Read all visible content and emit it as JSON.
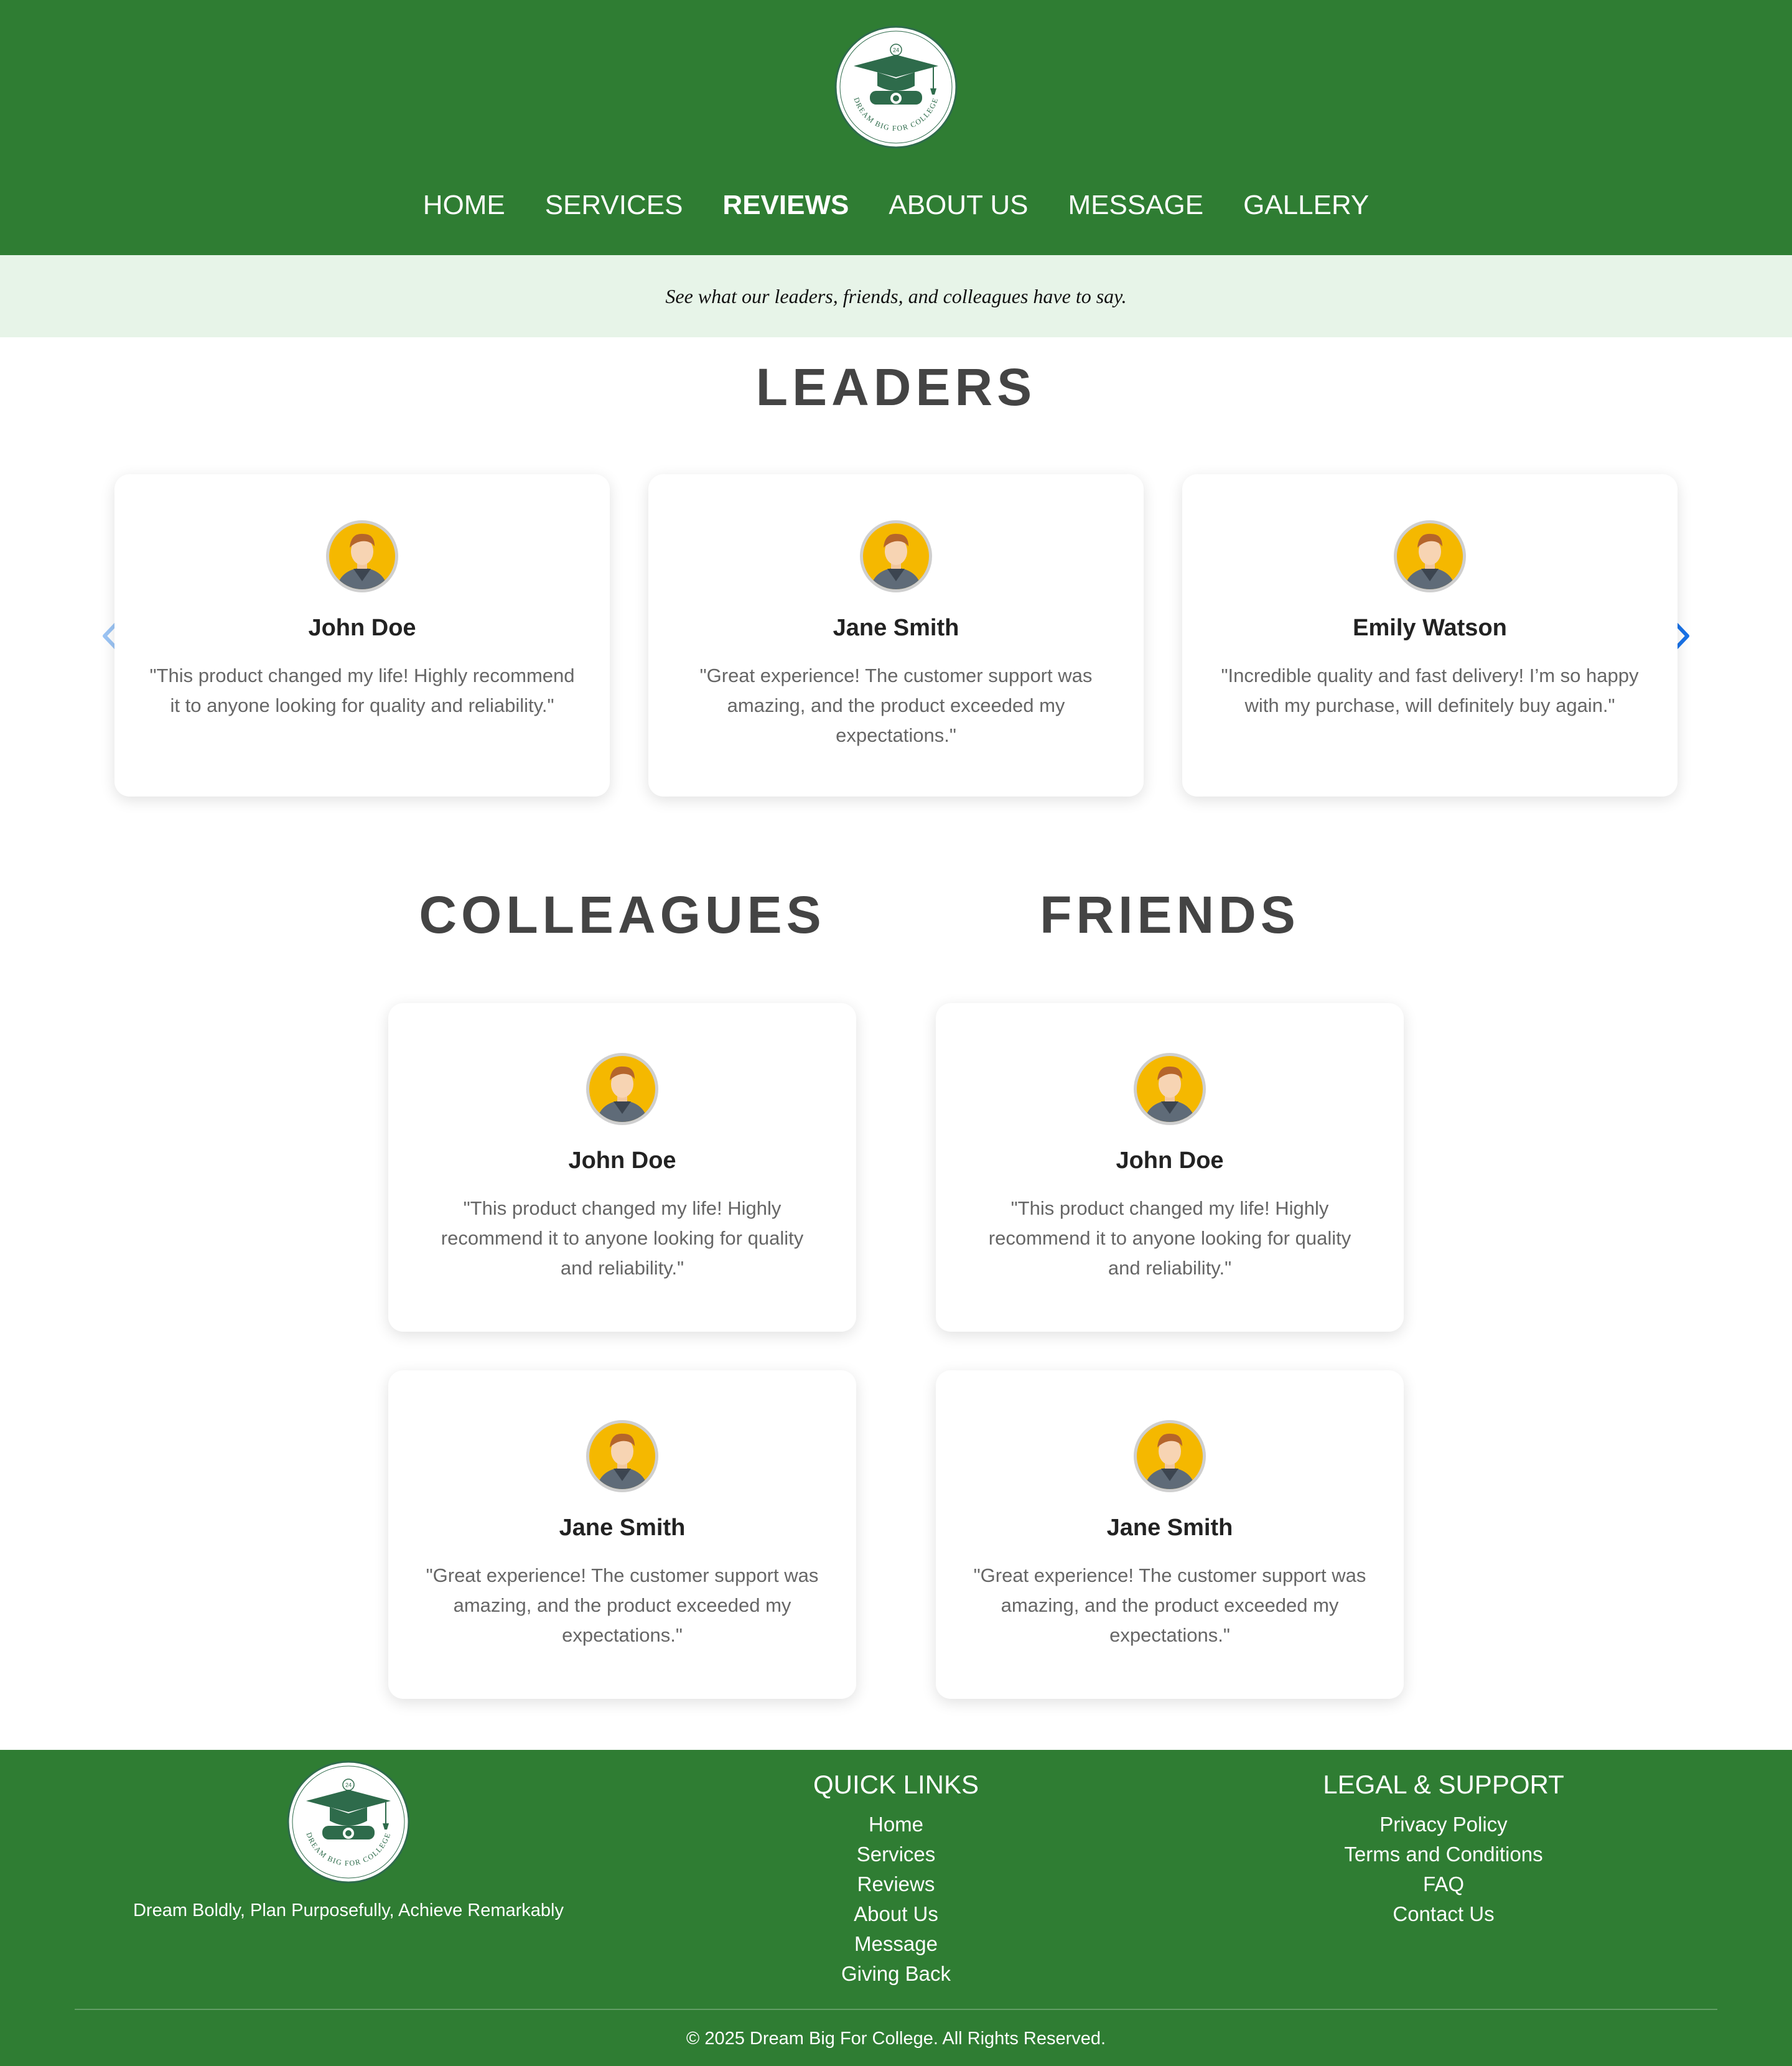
{
  "brand": {
    "primary": "#2f7d33",
    "banner_bg": "#e7f4e8",
    "arrow_color": "#1a73e8",
    "logo_text": "DREAM BIG FOR COLLEGE",
    "logo_badge": "24"
  },
  "nav": {
    "items": [
      {
        "label": "HOME"
      },
      {
        "label": "SERVICES"
      },
      {
        "label": "REVIEWS"
      },
      {
        "label": "ABOUT US"
      },
      {
        "label": "MESSAGE"
      },
      {
        "label": "GALLERY"
      }
    ],
    "active": "REVIEWS"
  },
  "banner": {
    "text": "See what our leaders, friends, and colleagues have to say."
  },
  "leaders": {
    "title": "LEADERS",
    "cards": [
      {
        "name": "John Doe",
        "quote": "\"This product changed my life! Highly recommend it to anyone looking for quality and reliability.\""
      },
      {
        "name": "Jane Smith",
        "quote": "\"Great experience! The customer support was amazing, and the product exceeded my expectations.\""
      },
      {
        "name": "Emily Watson",
        "quote": "\"Incredible quality and fast delivery! I’m so happy with my purchase, will definitely buy again.\""
      }
    ]
  },
  "colleagues": {
    "title": "COLLEAGUES",
    "cards": [
      {
        "name": "John Doe",
        "quote": "\"This product changed my life! Highly recommend it to anyone looking for quality and reliability.\""
      },
      {
        "name": "Jane Smith",
        "quote": "\"Great experience! The customer support was amazing, and the product exceeded my expectations.\""
      }
    ]
  },
  "friends": {
    "title": "FRIENDS",
    "cards": [
      {
        "name": "John Doe",
        "quote": "\"This product changed my life! Highly recommend it to anyone looking for quality and reliability.\""
      },
      {
        "name": "Jane Smith",
        "quote": "\"Great experience! The customer support was amazing, and the product exceeded my expectations.\""
      }
    ]
  },
  "footer": {
    "tagline": "Dream Boldly, Plan Purposefully, Achieve Remarkably",
    "quick_links": {
      "title": "QUICK LINKS",
      "items": [
        "Home",
        "Services",
        "Reviews",
        "About Us",
        "Message",
        "Giving Back"
      ]
    },
    "legal": {
      "title": "LEGAL & SUPPORT",
      "items": [
        "Privacy Policy",
        "Terms and Conditions",
        "FAQ",
        "Contact Us"
      ]
    },
    "copyright": "© 2025 Dream Big For College. All Rights Reserved."
  }
}
